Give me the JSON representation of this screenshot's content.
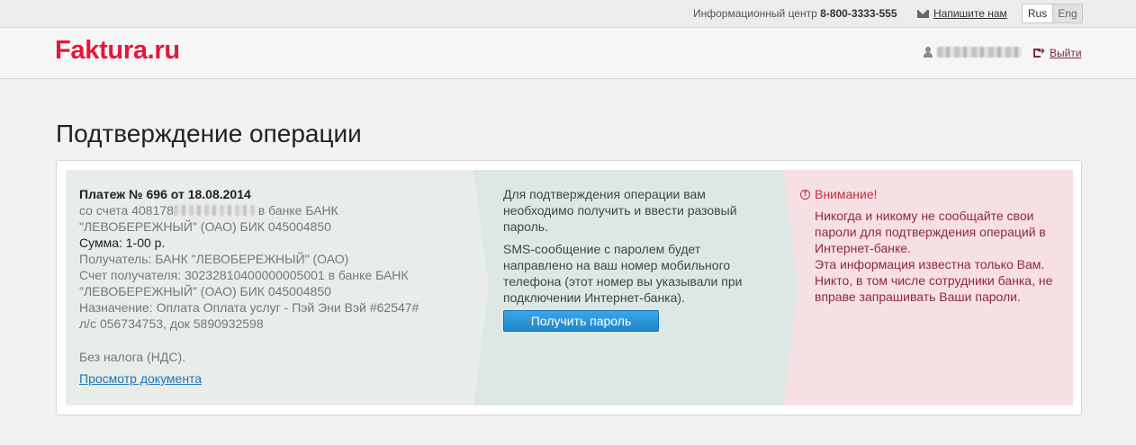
{
  "topbar": {
    "info_label": "Информационный центр",
    "info_phone": "8-800-3333-555",
    "write_us": "Напишите нам",
    "lang_rus": "Rus",
    "lang_eng": "Eng"
  },
  "header": {
    "logo": "Faktura.ru",
    "logout": "Выйти"
  },
  "page_title": "Подтверждение операции",
  "payment": {
    "heading": "Платеж № 696 от 18.08.2014",
    "account_prefix": "со счета 408178",
    "account_suffix": " в банке БАНК \"ЛЕВОБЕРЕЖНЫЙ\" (ОАО) БИК 045004850",
    "amount": "Сумма: 1-00 р.",
    "recipient": "Получатель: БАНК \"ЛЕВОБЕРЕЖНЫЙ\" (ОАО)",
    "recipient_account": "Счет получателя: 30232810400000005001 в банке БАНК \"ЛЕВОБЕРЕЖНЫЙ\" (ОАО) БИК 045004850",
    "purpose": "Назначение: Оплата Оплата услуг - Пэй Эни Вэй #62547# л/с 056734753, док 5890932598",
    "tax": "Без налога (НДС).",
    "view_doc": "Просмотр документа"
  },
  "sms": {
    "text1": "Для подтверждения операции вам необходимо получить и ввести разовый пароль.",
    "text2": "SMS-сообщение с паролем будет направлено на ваш номер мобильного телефона (этот номер вы указывали при подключении Интернет-банка).",
    "button": "Получить пароль"
  },
  "warning": {
    "title": "Внимание!",
    "text1": "Никогда и никому не сообщайте свои пароли для подтверждения операций в Интернет-банке.",
    "text2": "Эта информация известна только Вам. Никто, в том числе сотрудники банка, не вправе запрашивать Ваши пароли."
  }
}
